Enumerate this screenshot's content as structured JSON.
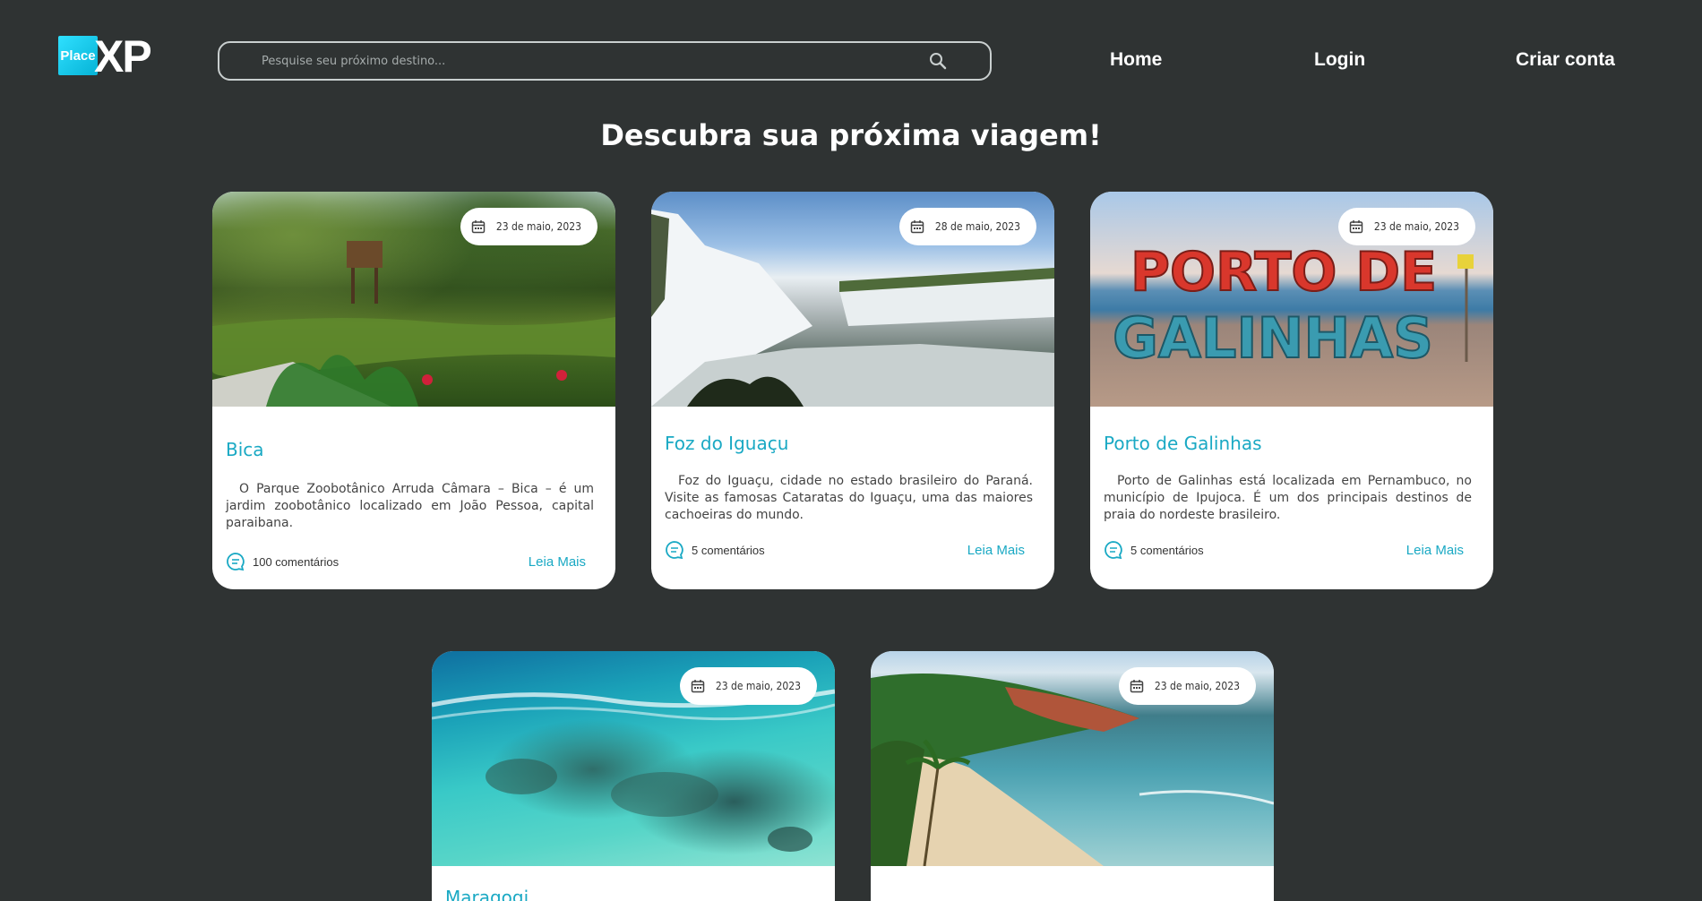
{
  "header": {
    "logo_small": "Place",
    "logo_big": "XP",
    "search_placeholder": "Pesquise seu próximo destino...",
    "nav": [
      "Home",
      "Login",
      "Criar conta"
    ]
  },
  "headline": "Descubra sua próxima viagem!",
  "cards": [
    {
      "date": "23 de maio, 2023",
      "title": "Bica",
      "description": "O Parque Zoobotânico Arruda Câmara – Bica – é um jardim zoobotânico localizado em João Pessoa, capital paraibana.",
      "comments": "100 comentários",
      "more": "Leia Mais"
    },
    {
      "date": "28 de maio, 2023",
      "title": "Foz do Iguaçu",
      "description": "Foz do Iguaçu, cidade no estado brasileiro do Paraná. Visite as famosas Cataratas do Iguaçu, uma das maiores cachoeiras do mundo.",
      "comments": "5 comentários",
      "more": "Leia Mais"
    },
    {
      "date": "23 de maio, 2023",
      "title": "Porto de Galinhas",
      "description": "Porto de Galinhas está localizada em Pernambuco, no município de Ipujoca. É um dos principais destinos de praia do nordeste brasileiro.",
      "comments": "5 comentários",
      "more": "Leia Mais",
      "sign_top": "PORTO DE",
      "sign_bottom": "GALINHAS"
    },
    {
      "date": "23 de maio, 2023",
      "title": "Maragogi"
    },
    {
      "date": "23 de maio, 2023",
      "title": ""
    }
  ],
  "colors": {
    "background": "#2f3333",
    "accent": "#1aa9c4",
    "logo_cyan": "#06b3d6"
  },
  "icons": [
    "search-icon",
    "calendar-icon",
    "comment-icon"
  ]
}
